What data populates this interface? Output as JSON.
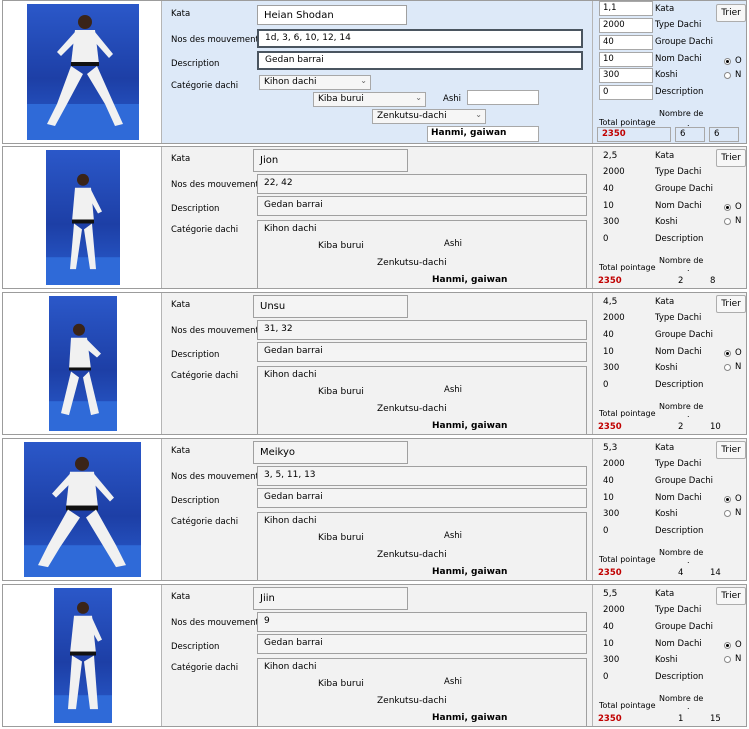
{
  "labels": {
    "kata": "Kata",
    "moves": "Nos des mouvements",
    "description": "Description",
    "category": "Catégorie dachi",
    "ashi": "Ashi",
    "kata_side": "Kata",
    "type_dachi": "Type Dachi",
    "groupe_dachi": "Groupe Dachi",
    "nom_dachi": "Nom Dachi",
    "koshi": "Koshi",
    "description_side": "Description",
    "total_pointage": "Total pointage",
    "nombre_de": "Nombre de",
    "nombre_dot": ".",
    "sort_button": "Trier",
    "radio_o": "O",
    "radio_n": "N"
  },
  "records": [
    {
      "kata": "Heian Shodan",
      "moves": "1d, 3, 6, 10, 12, 14",
      "description": "Gedan barrai",
      "cat_kihon": "Kihon dachi",
      "cat_kiba": "Kiba burui",
      "cat_zenkutsu": "Zenkutsu-dachi",
      "cat_hanmi": "Hanmi, gaiwan",
      "ashi": "",
      "side_kata": "1,1",
      "type_dachi": "2000",
      "groupe_dachi": "40",
      "nom_dachi": "10",
      "koshi": "300",
      "description_val": "0",
      "total": "2350",
      "count_a": "6",
      "count_b": "6"
    },
    {
      "kata": "Jion",
      "moves": "22, 42",
      "description": "Gedan barrai",
      "cat_kihon": "Kihon dachi",
      "cat_kiba": "Kiba burui",
      "cat_zenkutsu": "Zenkutsu-dachi",
      "cat_hanmi": "Hanmi, gaiwan",
      "side_kata": "2,5",
      "type_dachi": "2000",
      "groupe_dachi": "40",
      "nom_dachi": "10",
      "koshi": "300",
      "description_val": "0",
      "total": "2350",
      "count_a": "2",
      "count_b": "8"
    },
    {
      "kata": "Unsu",
      "moves": "31, 32",
      "description": "Gedan barrai",
      "cat_kihon": "Kihon dachi",
      "cat_kiba": "Kiba burui",
      "cat_zenkutsu": "Zenkutsu-dachi",
      "cat_hanmi": "Hanmi, gaiwan",
      "side_kata": "4,5",
      "type_dachi": "2000",
      "groupe_dachi": "40",
      "nom_dachi": "10",
      "koshi": "300",
      "description_val": "0",
      "total": "2350",
      "count_a": "2",
      "count_b": "10"
    },
    {
      "kata": "Meikyo",
      "moves": "3, 5, 11, 13",
      "description": "Gedan barrai",
      "cat_kihon": "Kihon dachi",
      "cat_kiba": "Kiba burui",
      "cat_zenkutsu": "Zenkutsu-dachi",
      "cat_hanmi": "Hanmi, gaiwan",
      "side_kata": "5,3",
      "type_dachi": "2000",
      "groupe_dachi": "40",
      "nom_dachi": "10",
      "koshi": "300",
      "description_val": "0",
      "total": "2350",
      "count_a": "4",
      "count_b": "14"
    },
    {
      "kata": "Jiin",
      "moves": "9",
      "description": "Gedan barrai",
      "cat_kihon": "Kihon dachi",
      "cat_kiba": "Kiba burui",
      "cat_zenkutsu": "Zenkutsu-dachi",
      "cat_hanmi": "Hanmi, gaiwan",
      "side_kata": "5,5",
      "type_dachi": "2000",
      "groupe_dachi": "40",
      "nom_dachi": "10",
      "koshi": "300",
      "description_val": "0",
      "total": "2350",
      "count_a": "1",
      "count_b": "15"
    }
  ],
  "colors": {
    "active_row": "#dde9f8",
    "inactive_row": "#f2f2f2",
    "photo_blue": "#2b58c9",
    "total_red": "#c00000"
  }
}
